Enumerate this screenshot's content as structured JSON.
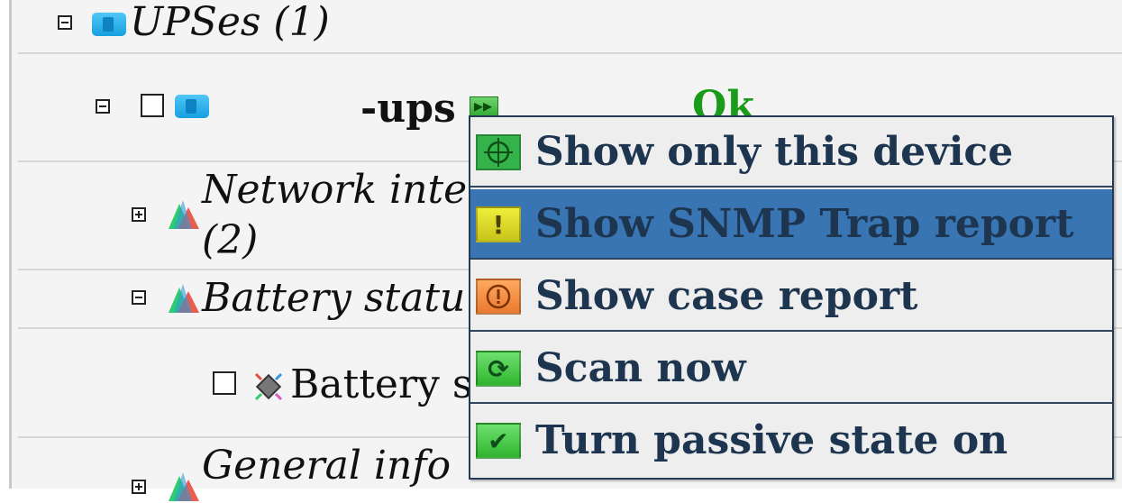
{
  "tree": {
    "group_label": "UPSes (1)",
    "device_name_suffix": "-ups",
    "device_status": "Ok",
    "network_label": "Network inte",
    "network_count": "(2)",
    "battery_status_label": "Battery statu",
    "battery_sensor_label": "Battery s",
    "general_info_label": "General info"
  },
  "context_menu": {
    "items": [
      {
        "label": "Show only this device",
        "icon": "crosshair-icon",
        "color": "#34b34a"
      },
      {
        "label": "Show SNMP Trap report",
        "icon": "warning-icon",
        "color": "#d4d21f"
      },
      {
        "label": "Show case report",
        "icon": "case-warning-icon",
        "color": "#f08a3c"
      },
      {
        "label": "Scan now",
        "icon": "refresh-icon",
        "color": "#3fbf3f"
      },
      {
        "label": "Turn passive state on",
        "icon": "check-icon",
        "color": "#3fbf3f"
      }
    ],
    "highlighted_index": 1,
    "highlight_color": "#3975b2"
  },
  "colors": {
    "status_ok": "#1a9b1a",
    "menu_text": "#1e3550"
  }
}
